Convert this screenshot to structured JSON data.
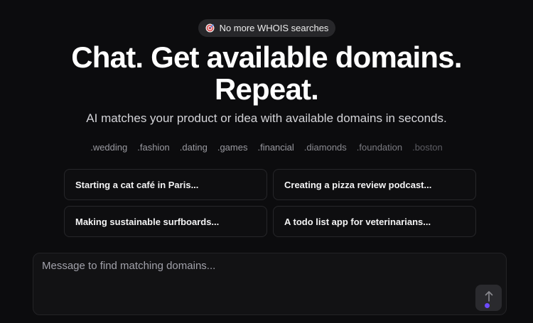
{
  "badge": {
    "icon": "target-icon",
    "label": "No more WHOIS searches"
  },
  "hero": {
    "line1": "Chat. Get available domains.",
    "line2": "Repeat."
  },
  "subtitle": "AI matches your product or idea with available domains in seconds.",
  "tlds": [
    {
      "label": ".wedding",
      "color": "#9a9aa0"
    },
    {
      "label": ".fashion",
      "color": "#9a9aa0"
    },
    {
      "label": ".dating",
      "color": "#9a9aa0"
    },
    {
      "label": ".games",
      "color": "#9a9aa0"
    },
    {
      "label": ".financial",
      "color": "#9a9aa0"
    },
    {
      "label": ".diamonds",
      "color": "#8a8a90"
    },
    {
      "label": ".foundation",
      "color": "#7a7a80"
    },
    {
      "label": ".boston",
      "color": "#5c5c62"
    }
  ],
  "suggestions": [
    "Starting a cat café in Paris...",
    "Creating a pizza review podcast...",
    "Making sustainable surfboards...",
    "A todo list app for veterinarians..."
  ],
  "composer": {
    "placeholder": "Message to find matching domains...",
    "send_icon": "arrow-up-icon",
    "accent": "#6d4aff"
  }
}
